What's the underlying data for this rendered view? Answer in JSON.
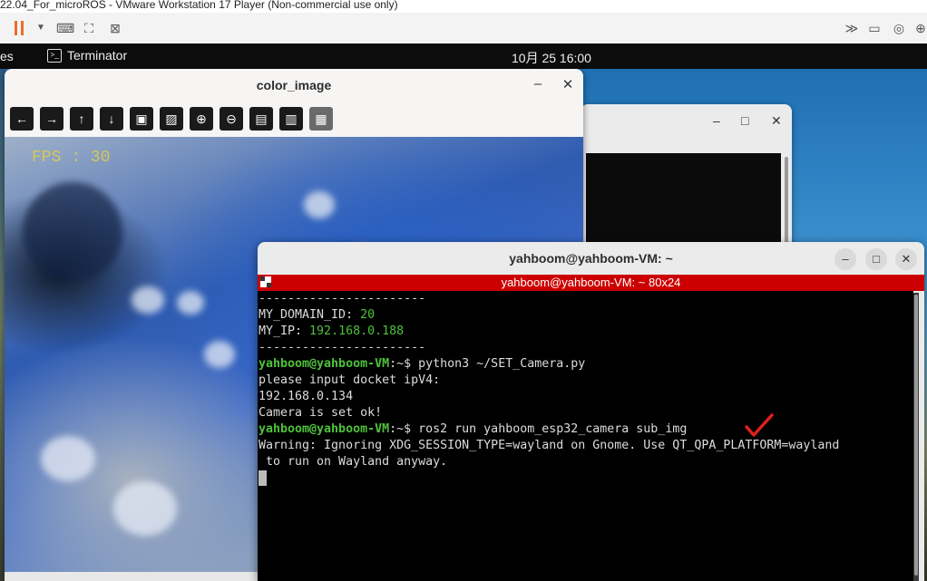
{
  "vmware": {
    "title": "22.04_For_microROS - VMware Workstation 17 Player (Non-commercial use only)"
  },
  "gnome_bar": {
    "activities": "es",
    "app_name": "Terminator",
    "clock": "10月 25  16:00"
  },
  "image_window": {
    "title": "color_image",
    "fps_label": "FPS : 30",
    "toolbar_icons": [
      "arrow-left-icon",
      "arrow-right-icon",
      "arrow-up-icon",
      "arrow-down-icon",
      "image-icon",
      "image-params-icon",
      "zoom-in-icon",
      "zoom-out-icon",
      "save-icon",
      "clipboard-icon",
      "properties-icon"
    ]
  },
  "terminal_window": {
    "title": "yahboom@yahboom-VM: ~",
    "tab_title": "yahboom@yahboom-VM: ~ 80x24",
    "lines": {
      "sep1": "-----------------------",
      "domain_key": "MY_DOMAIN_ID: ",
      "domain_val": "20",
      "ip_key": "MY_IP: ",
      "ip_val": "192.168.0.188",
      "sep2": "-----------------------",
      "prompt1": "yahboom@yahboom-VM",
      "cmd1": ":~$ python3 ~/SET_Camera.py",
      "out1": "please input docket ipV4:",
      "out2": "192.168.0.134",
      "out3": "Camera is set ok!",
      "prompt2": "yahboom@yahboom-VM",
      "cmd2": ":~$ ros2 run yahboom_esp32_camera sub_img",
      "warn1": "Warning: Ignoring XDG_SESSION_TYPE=wayland on Gnome. Use QT_QPA_PLATFORM=wayland",
      "warn2": " to run on Wayland anyway."
    }
  },
  "colors": {
    "tab_red": "#cc0000",
    "prompt_green": "#4ec23b",
    "check_red": "#e0201a"
  }
}
